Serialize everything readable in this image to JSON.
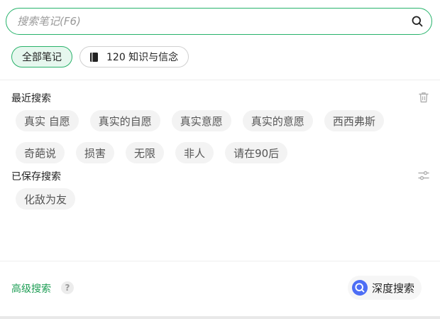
{
  "search": {
    "placeholder": "搜索笔记(F6)",
    "value": ""
  },
  "filters": [
    {
      "label": "全部笔记",
      "active": true
    },
    {
      "label": "120 知识与信念",
      "active": false
    }
  ],
  "recent": {
    "title": "最近搜索",
    "row1": [
      "真实 自愿",
      "真实的自愿",
      "真实意愿",
      "真实的意愿",
      "西西弗斯"
    ],
    "row2": [
      "奇葩说",
      "损害",
      "无限",
      "非人",
      "请在90后"
    ]
  },
  "saved": {
    "title": "已保存搜索",
    "items": [
      "化敌为友"
    ]
  },
  "footer": {
    "advanced_label": "高级搜索",
    "help_glyph": "?",
    "deep_search_label": "深度搜索"
  },
  "colors": {
    "accent": "#27b36b",
    "accent_text": "#1e9e55",
    "chip_bg": "#f3f3f3",
    "deep_search_icon": "#4d6ef5"
  },
  "icons": {
    "search": "search-icon",
    "notebook": "notebook-icon",
    "trash": "trash-icon",
    "settings": "sliders-icon",
    "help": "help-icon",
    "deep_search": "deep-search-icon"
  }
}
